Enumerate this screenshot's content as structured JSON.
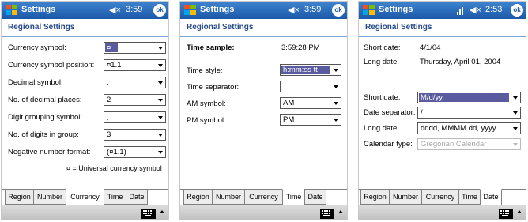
{
  "screens": {
    "currency": {
      "title": "Settings",
      "volume": "◀×",
      "time": "3:59",
      "ok": "ok",
      "header": "Regional Settings",
      "rows": [
        {
          "label": "Currency symbol:",
          "value": "¤"
        },
        {
          "label": "Currency symbol position:",
          "value": "¤1.1"
        },
        {
          "label": "Decimal symbol:",
          "value": "."
        },
        {
          "label": "No. of decimal places:",
          "value": "2"
        },
        {
          "label": "Digit grouping symbol:",
          "value": ","
        },
        {
          "label": "No. of digits in group:",
          "value": "3"
        },
        {
          "label": "Negative number format:",
          "value": "(¤1.1)"
        }
      ],
      "note": "¤ = Universal currency symbol",
      "tabs": [
        "Region",
        "Number",
        "Currency",
        "Time",
        "Date"
      ],
      "active_tab": "Currency"
    },
    "time": {
      "title": "Settings",
      "volume": "◀×",
      "time": "3:59",
      "ok": "ok",
      "header": "Regional Settings",
      "sample_label": "Time sample:",
      "sample_value": "3:59:28 PM",
      "rows": [
        {
          "label": "Time style:",
          "value": "h:mm:ss tt"
        },
        {
          "label": "Time separator:",
          "value": ":"
        },
        {
          "label": "AM symbol:",
          "value": "AM"
        },
        {
          "label": "PM symbol:",
          "value": "PM"
        }
      ],
      "tabs": [
        "Region",
        "Number",
        "Currency",
        "Time",
        "Date"
      ],
      "active_tab": "Time"
    },
    "date": {
      "title": "Settings",
      "volume": "◀×",
      "time": "2:53",
      "ok": "ok",
      "header": "Regional Settings",
      "samples": [
        {
          "label": "Short date:",
          "value": "4/1/04"
        },
        {
          "label": "Long date:",
          "value": "Thursday, April 01, 2004"
        }
      ],
      "rows": [
        {
          "label": "Short date:",
          "value": "M/d/yy"
        },
        {
          "label": "Date separator:",
          "value": "/"
        },
        {
          "label": "Long date:",
          "value": "dddd, MMMM dd, yyyy"
        },
        {
          "label": "Calendar type:",
          "value": "Gregorian Calendar"
        }
      ],
      "tabs": [
        "Region",
        "Number",
        "Currency",
        "Time",
        "Date"
      ],
      "active_tab": "Date"
    }
  },
  "colors": {
    "titlebar": "#1b58a8",
    "header_text": "#244a8a",
    "focus": "#5a5a9e"
  }
}
